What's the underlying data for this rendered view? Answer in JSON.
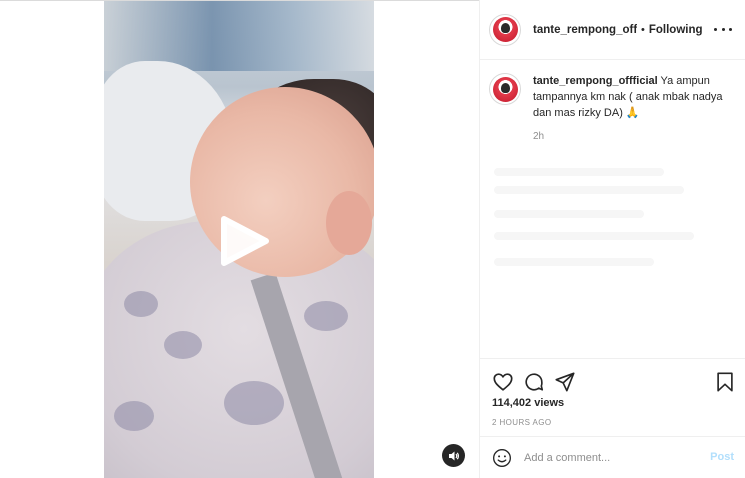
{
  "post": {
    "username": "tante_rempong_offficial",
    "dot": "•",
    "follow_state": "Following",
    "caption_user": "tante_rempong_offficial",
    "caption_text": "Ya ampun tampannya km nak ( anak mbak nadya dan mas rizky DA) 🙏",
    "caption_age": "2h",
    "views": "114,402 views",
    "posted_ago": "2 HOURS AGO"
  },
  "comment": {
    "placeholder": "Add a comment...",
    "post_label": "Post"
  },
  "icons": {
    "play": "play-icon",
    "sound": "volume-icon",
    "more": "more-options-icon",
    "like": "heart-icon",
    "comment": "comment-icon",
    "share": "share-icon",
    "save": "bookmark-icon",
    "emoji": "emoji-icon"
  },
  "colors": {
    "text": "#262626",
    "muted": "#8e8e8e",
    "post_disabled": "#b2dffc",
    "border": "#efefef"
  }
}
